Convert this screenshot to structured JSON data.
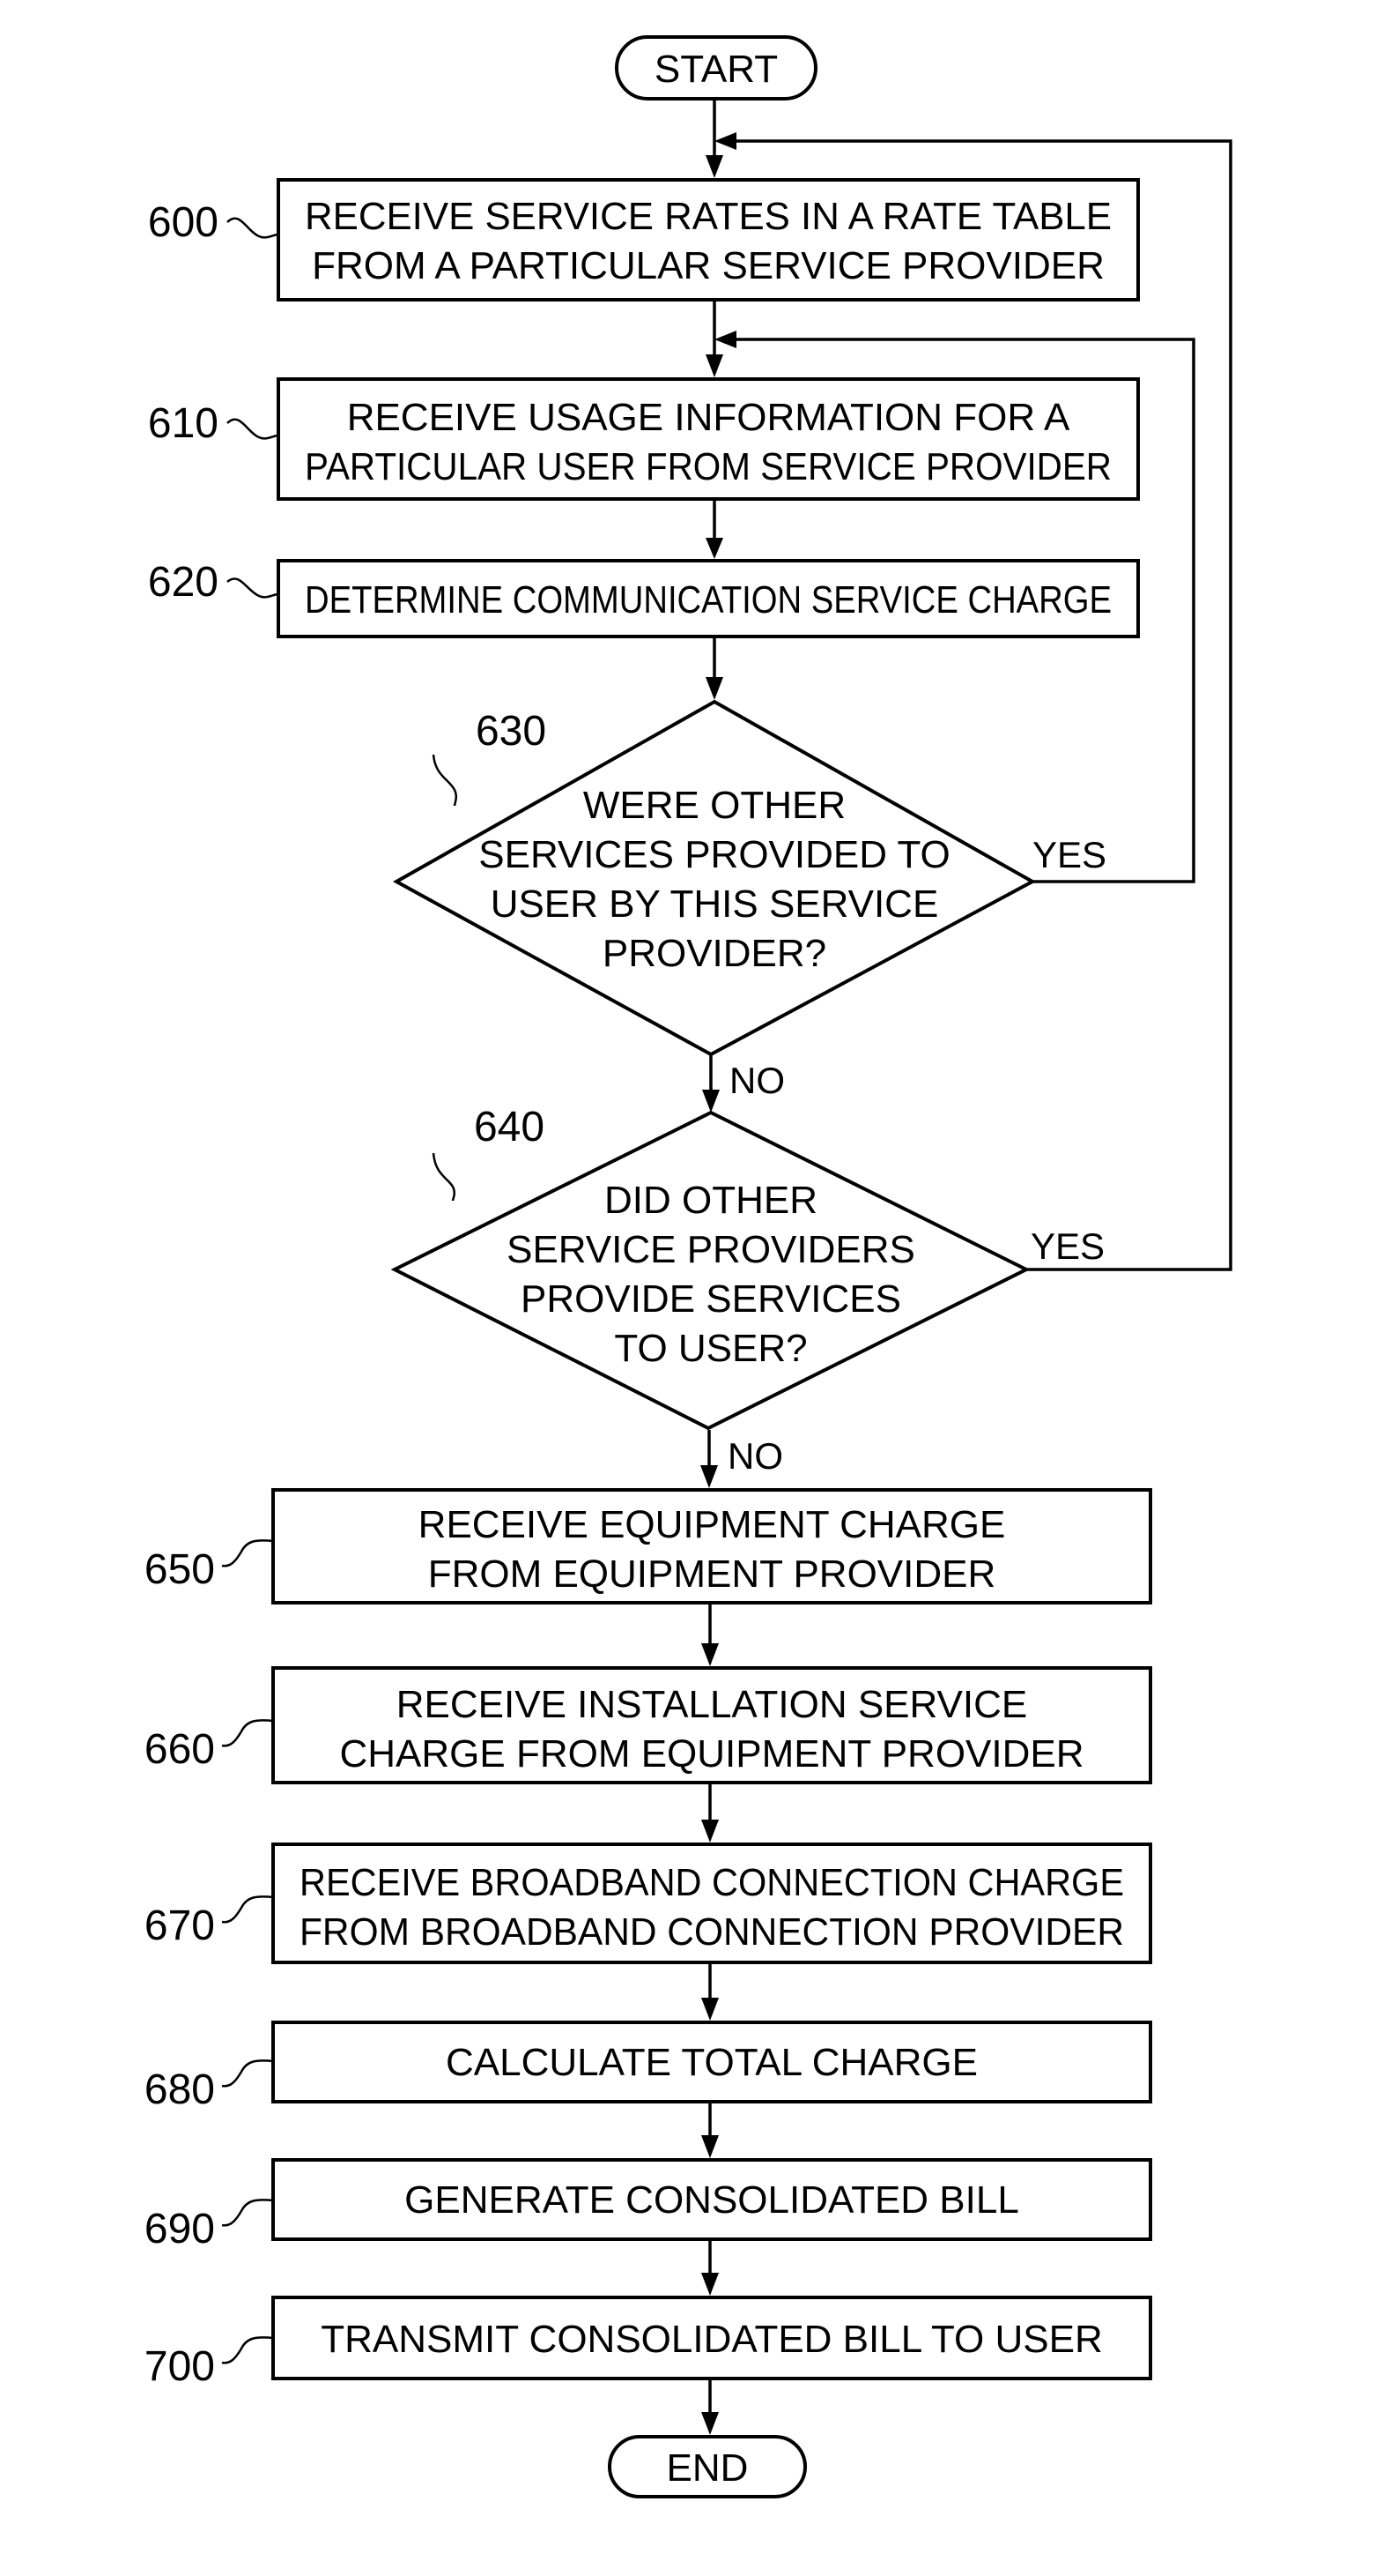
{
  "diagram": {
    "type": "flowchart",
    "start": {
      "label": "START"
    },
    "end": {
      "label": "END"
    },
    "steps": [
      {
        "id": "600",
        "lines": [
          "RECEIVE SERVICE RATES IN A RATE TABLE",
          "FROM A PARTICULAR SERVICE PROVIDER"
        ]
      },
      {
        "id": "610",
        "lines": [
          "RECEIVE USAGE INFORMATION FOR A",
          "PARTICULAR USER FROM SERVICE PROVIDER"
        ]
      },
      {
        "id": "620",
        "lines": [
          "DETERMINE COMMUNICATION SERVICE CHARGE"
        ]
      },
      {
        "id": "650",
        "lines": [
          "RECEIVE EQUIPMENT CHARGE",
          "FROM EQUIPMENT PROVIDER"
        ]
      },
      {
        "id": "660",
        "lines": [
          "RECEIVE INSTALLATION SERVICE",
          "CHARGE FROM EQUIPMENT PROVIDER"
        ]
      },
      {
        "id": "670",
        "lines": [
          "RECEIVE BROADBAND CONNECTION CHARGE",
          "FROM BROADBAND CONNECTION PROVIDER"
        ]
      },
      {
        "id": "680",
        "lines": [
          "CALCULATE TOTAL CHARGE"
        ]
      },
      {
        "id": "690",
        "lines": [
          "GENERATE CONSOLIDATED BILL"
        ]
      },
      {
        "id": "700",
        "lines": [
          "TRANSMIT CONSOLIDATED BILL TO USER"
        ]
      }
    ],
    "decisions": [
      {
        "id": "630",
        "lines": [
          "WERE OTHER",
          "SERVICES PROVIDED TO",
          "USER BY THIS SERVICE",
          "PROVIDER?"
        ],
        "yes_label": "YES",
        "no_label": "NO",
        "yes_target": "610"
      },
      {
        "id": "640",
        "lines": [
          "DID OTHER",
          "SERVICE PROVIDERS",
          "PROVIDE SERVICES",
          "TO USER?"
        ],
        "yes_label": "YES",
        "no_label": "NO",
        "yes_target": "600"
      }
    ]
  }
}
